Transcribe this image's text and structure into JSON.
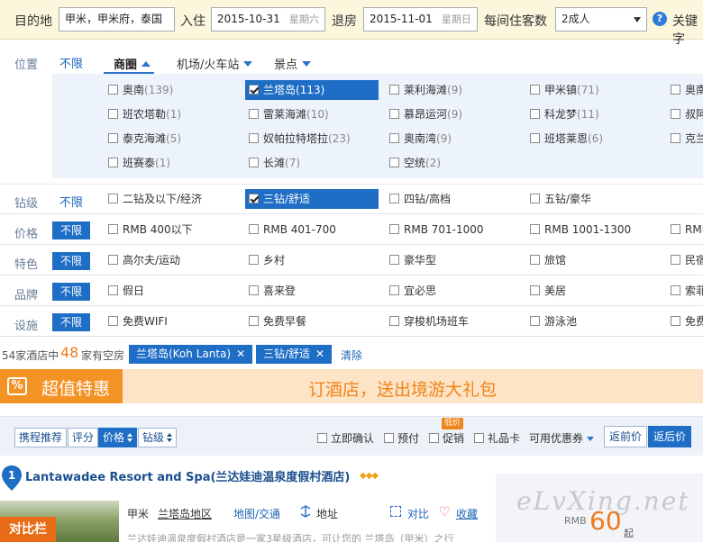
{
  "search": {
    "dest_label": "目的地",
    "dest_value": "甲米，甲米府，泰国",
    "checkin_label": "入住",
    "checkin_date": "2015-10-31",
    "checkin_week": "星期六",
    "checkout_label": "退房",
    "checkout_date": "2015-11-01",
    "checkout_week": "星期日",
    "guests_label": "每间住客数",
    "guests_value": "2成人",
    "help_glyph": "?",
    "keyword_label": "关键字"
  },
  "filters": {
    "location": {
      "label": "位置",
      "unlimited": "不限",
      "tabs": [
        "商圈",
        "机场/火车站",
        "景点"
      ],
      "areas": [
        {
          "name": "奥南",
          "count": "(139)",
          "checked": false
        },
        {
          "name": "兰塔岛",
          "count": "(113)",
          "checked": true
        },
        {
          "name": "莱利海滩",
          "count": "(9)",
          "checked": false
        },
        {
          "name": "甲米镇",
          "count": "(71)",
          "checked": false
        },
        {
          "name": "奥南",
          "count": "",
          "checked": false
        },
        {
          "name": "班农塔勒",
          "count": "(1)",
          "checked": false
        },
        {
          "name": "雷莱海滩",
          "count": "(10)",
          "checked": false
        },
        {
          "name": "慕昂运河",
          "count": "(9)",
          "checked": false
        },
        {
          "name": "科龙梦",
          "count": "(11)",
          "checked": false
        },
        {
          "name": "叔阿",
          "count": "",
          "checked": false
        },
        {
          "name": "泰克海滩",
          "count": "(5)",
          "checked": false
        },
        {
          "name": "奴帕拉特塔拉",
          "count": "(23)",
          "checked": false
        },
        {
          "name": "奥南湾",
          "count": "(9)",
          "checked": false
        },
        {
          "name": "班塔莱恩",
          "count": "(6)",
          "checked": false
        },
        {
          "name": "克兰",
          "count": "",
          "checked": false
        },
        {
          "name": "班赛泰",
          "count": "(1)",
          "checked": false
        },
        {
          "name": "长滩",
          "count": "(7)",
          "checked": false
        },
        {
          "name": "空统",
          "count": "(2)",
          "checked": false
        }
      ]
    },
    "star": {
      "label": "钻级",
      "unlimited": "不限",
      "options": [
        {
          "name": "二钻及以下/经济",
          "checked": false
        },
        {
          "name": "三钻/舒适",
          "checked": true
        },
        {
          "name": "四钻/高档",
          "checked": false
        },
        {
          "name": "五钻/豪华",
          "checked": false
        }
      ]
    },
    "price": {
      "label": "价格",
      "unlimited": "不限",
      "options": [
        "RMB 400以下",
        "RMB 401-700",
        "RMB 701-1000",
        "RMB 1001-1300",
        "RMB"
      ]
    },
    "feature": {
      "label": "特色",
      "unlimited": "不限",
      "options": [
        "高尔夫/运动",
        "乡村",
        "豪华型",
        "旅馆",
        "民宿"
      ]
    },
    "brand": {
      "label": "品牌",
      "unlimited": "不限",
      "options": [
        "假日",
        "喜来登",
        "宜必思",
        "美居",
        "索菲"
      ]
    },
    "facility": {
      "label": "设施",
      "unlimited": "不限",
      "options": [
        "免费WIFI",
        "免费早餐",
        "穿梭机场班车",
        "游泳池",
        "免费"
      ]
    }
  },
  "summary": {
    "prefix": "54家酒店中",
    "count": "48",
    "suffix": "家有空房",
    "tags": [
      "兰塔岛(Koh Lanta)",
      "三钻/舒适"
    ],
    "tag_close": "✕",
    "clear": "清除"
  },
  "promo": {
    "icon": "%",
    "title": "超值特惠",
    "message": "订酒店，送出境游大礼包"
  },
  "sortbar": {
    "sorts": [
      "携程推荐",
      "评分",
      "价格",
      "钻级"
    ],
    "options": [
      "立即确认",
      "预付",
      "促销",
      "礼品卡"
    ],
    "promo_badge": "低价",
    "coupon": "可用优惠券",
    "price_modes": [
      "返前价",
      "返后价"
    ]
  },
  "hotel": {
    "rank": "1",
    "name": "Lantawadee Resort and Spa(兰达娃迪温泉度假村酒店)",
    "diamonds": "◆◆◆",
    "compare_tag": "对比栏",
    "city": "甲米",
    "area": "兰塔岛地区",
    "traffic": "地图/交通",
    "address": "地址",
    "compare": "对比",
    "favorite": "收藏",
    "description": "兰达娃迪温泉度假村酒店是一家3星级酒店，可让您的 兰塔岛（甲米）之行",
    "price_currency": "RMB",
    "price_value": "60",
    "price_suffix": "起"
  },
  "watermark": "eLvXing.net",
  "colors": {
    "accent": "#1f6ec5",
    "orange": "#f39225",
    "price": "#f07a1a"
  }
}
